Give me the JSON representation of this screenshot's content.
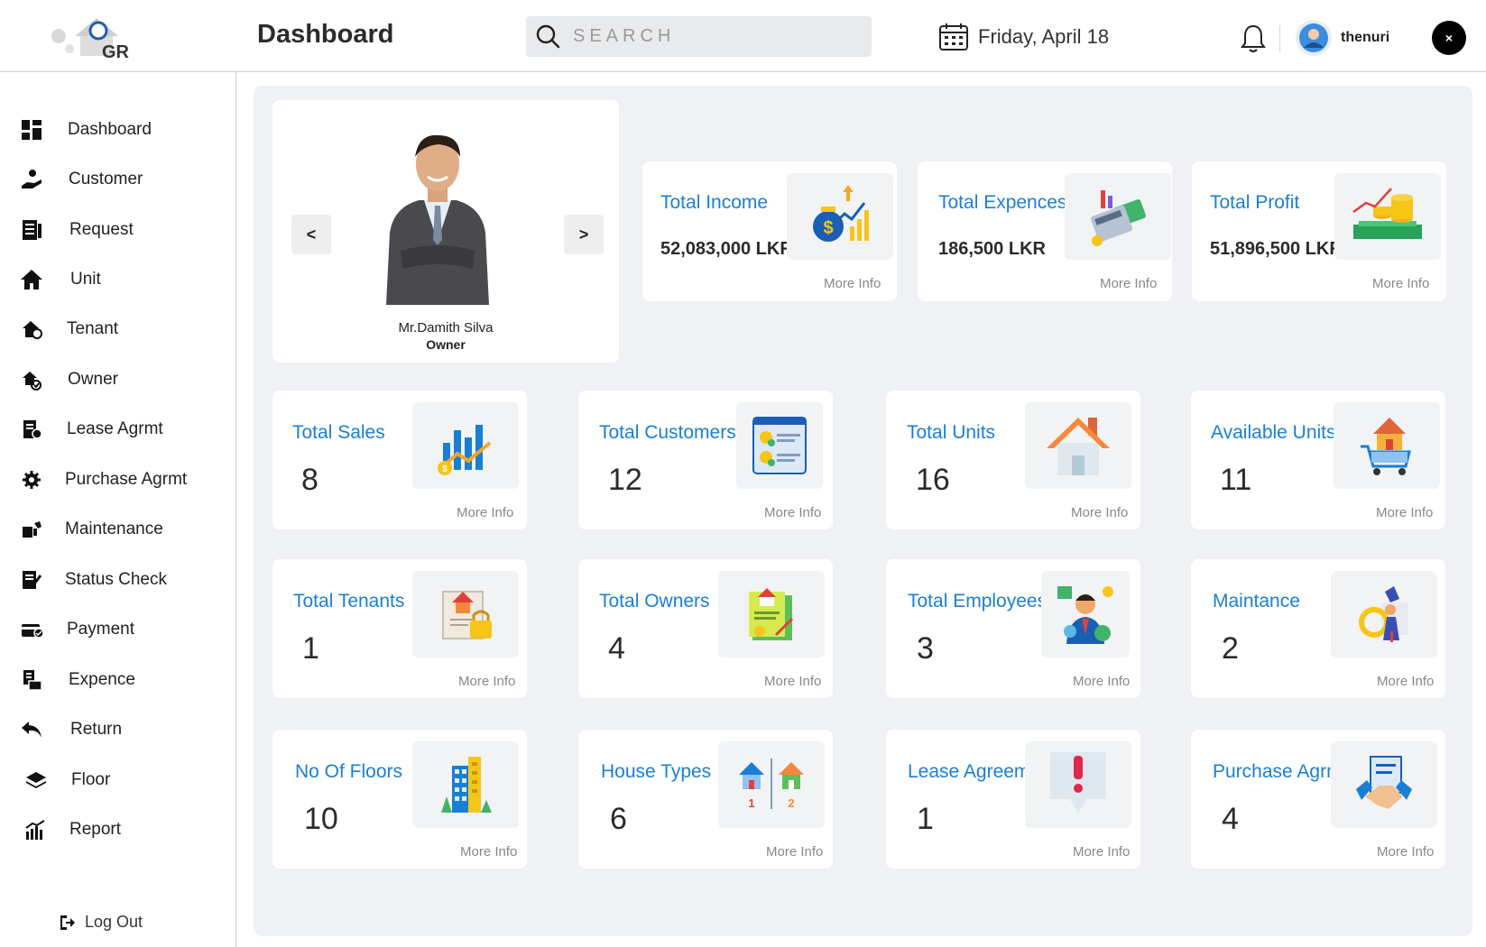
{
  "header": {
    "title": "Dashboard",
    "search_placeholder": "SEARCH",
    "date": "Friday, April 18",
    "username": "thenuri",
    "close_label": "×"
  },
  "sidebar": {
    "items": [
      {
        "label": "Dashboard",
        "icon": "dashboard-grid-icon"
      },
      {
        "label": "Customer",
        "icon": "customer-hand-icon"
      },
      {
        "label": "Request",
        "icon": "request-list-icon"
      },
      {
        "label": "Unit",
        "icon": "home-icon"
      },
      {
        "label": "Tenant",
        "icon": "tenant-icon"
      },
      {
        "label": "Owner",
        "icon": "owner-icon"
      },
      {
        "label": "Lease Agrmt",
        "icon": "lease-icon"
      },
      {
        "label": "Purchase Agrmt",
        "icon": "purchase-gear-icon"
      },
      {
        "label": "Maintenance",
        "icon": "maintenance-icon"
      },
      {
        "label": "Status Check",
        "icon": "status-check-icon"
      },
      {
        "label": "Payment",
        "icon": "payment-icon"
      },
      {
        "label": "Expence",
        "icon": "expence-icon"
      },
      {
        "label": "Return",
        "icon": "return-arrow-icon"
      },
      {
        "label": "Floor",
        "icon": "floor-layers-icon"
      },
      {
        "label": "Report",
        "icon": "report-chart-icon"
      }
    ],
    "logout": "Log  Out"
  },
  "profile": {
    "prev": "<",
    "next": ">",
    "name": "Mr.Damith Silva",
    "role": "Owner"
  },
  "money_cards": [
    {
      "title": "Total Income",
      "value": "52,083,000 LKR",
      "more": "More Info",
      "icon": "income-moneybag-icon"
    },
    {
      "title": "Total Expences",
      "value": "186,500 LKR",
      "more": "More Info",
      "icon": "expences-calculator-icon"
    },
    {
      "title": "Total Profit",
      "value": "51,896,500 LKR",
      "more": "More Info",
      "icon": "profit-coins-icon"
    }
  ],
  "stat_cards": [
    {
      "title": "Total Sales",
      "value": "8",
      "more": "More Info",
      "icon": "sales-chart-icon"
    },
    {
      "title": "Total Customers",
      "value": "12",
      "more": "More Info",
      "icon": "customers-profile-icon"
    },
    {
      "title": "Total Units",
      "value": "16",
      "more": "More Info",
      "icon": "units-house-icon"
    },
    {
      "title": "Available Units",
      "value": "11",
      "more": "More Info",
      "icon": "available-cart-icon"
    },
    {
      "title": "Total Tenants",
      "value": "1",
      "more": "More Info",
      "icon": "tenants-lock-icon"
    },
    {
      "title": "Total Owners",
      "value": "4",
      "more": "More Info",
      "icon": "owners-document-icon"
    },
    {
      "title": "Total Employees",
      "value": "3",
      "more": "More Info",
      "icon": "employees-person-icon"
    },
    {
      "title": "Maintance",
      "value": "2",
      "more": "More Info",
      "icon": "maintance-worker-icon"
    },
    {
      "title": "No Of Floors",
      "value": "10",
      "more": "More Info",
      "icon": "floors-building-icon"
    },
    {
      "title": "House Types",
      "value": "6",
      "more": "More Info",
      "icon": "house-types-icon"
    },
    {
      "title": "Lease Agreement",
      "value": "1",
      "more": "More Info",
      "icon": "lease-alert-icon"
    },
    {
      "title": "Purchase Agrmt",
      "value": "4",
      "more": "More Info",
      "icon": "purchase-handshake-icon"
    }
  ]
}
